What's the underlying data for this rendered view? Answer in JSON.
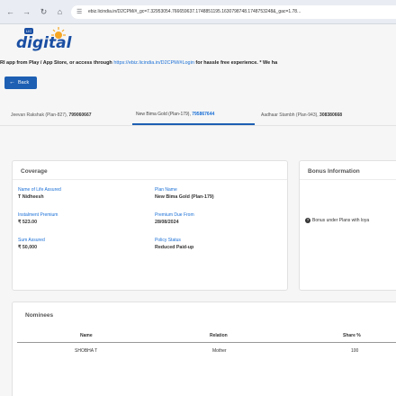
{
  "browser": {
    "back_icon": "arrow-left",
    "forward_icon": "arrow-right",
    "reload_icon": "reload",
    "home_icon": "home",
    "site_icon": "tune",
    "url": "ebiz.licindia.in/D2CPM/#_gc=7.32953054.766659637.1748851195.1630798748.1748753248&_gac=1.78..."
  },
  "logo": {
    "badge": "LIC",
    "text": "digital"
  },
  "notice": {
    "prefix": "RI app from Play / App Store, or access through ",
    "link": "https://ebiz.licindia.in/D2CPM/#Login",
    "suffix": " for hassle free experience.   * We ha"
  },
  "back_button": {
    "icon": "arrow-left",
    "label": "Back"
  },
  "tabs": [
    {
      "name": "Jeevan Rakshak (Plan-827), ",
      "number": "799060667"
    },
    {
      "name": "New Bima Gold (Plan-179), ",
      "number": "795867644"
    },
    {
      "name": "Aadhaar Stambh (Plan-943), ",
      "number": "308380668"
    }
  ],
  "coverage": {
    "title": "Coverage",
    "fields": {
      "life_assured": {
        "label": "Name of Life Assured",
        "value": "T Nidheesh"
      },
      "plan_name": {
        "label": "Plan Name",
        "value": "New Bima Gold (Plan-179)"
      },
      "premium": {
        "label": "Instalment Premium",
        "value": "₹ 523.00"
      },
      "due_from": {
        "label": "Premium Due From",
        "value": "28/08/2024"
      },
      "sum_assured": {
        "label": "Sum Assured",
        "value": "₹ 50,000"
      },
      "status": {
        "label": "Policy Status",
        "value": "Reduced Paid-up"
      }
    }
  },
  "bonus": {
    "title": "Bonus Information",
    "note": "Bonus under Plans with loya"
  },
  "nominees": {
    "title": "Nominees",
    "headers": {
      "name": "Name",
      "relation": "Relation",
      "share": "Share %"
    },
    "rows": [
      {
        "name": "SHOBHA T",
        "relation": "Mother",
        "share": "100"
      }
    ]
  }
}
